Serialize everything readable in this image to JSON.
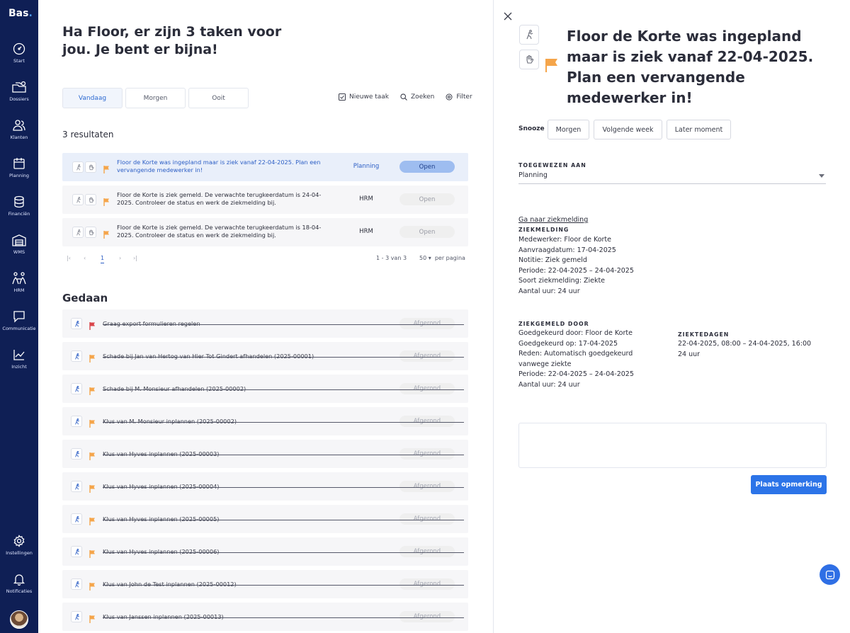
{
  "app": {
    "logo": "Bas",
    "logo_dot": "."
  },
  "sidebar": {
    "items": [
      {
        "label": "Start",
        "icon": "gauge-icon"
      },
      {
        "label": "Dossiers",
        "icon": "folders-icon"
      },
      {
        "label": "Klanten",
        "icon": "users-icon"
      },
      {
        "label": "Planning",
        "icon": "calendar-icon"
      },
      {
        "label": "Financiën",
        "icon": "coins-icon"
      },
      {
        "label": "WMS",
        "icon": "warehouse-icon"
      },
      {
        "label": "HRM",
        "icon": "people-icon"
      },
      {
        "label": "Communicatie",
        "icon": "chat-icon"
      },
      {
        "label": "Inzicht",
        "icon": "chart-icon"
      }
    ],
    "bottom": [
      {
        "label": "Instellingen",
        "icon": "gear-icon"
      },
      {
        "label": "Notificaties",
        "icon": "bell-icon"
      }
    ]
  },
  "main": {
    "greeting": "Ha Floor, er zijn 3 taken voor jou. Je bent er bijna!",
    "tabs": [
      {
        "label": "Vandaag",
        "active": true
      },
      {
        "label": "Morgen",
        "active": false
      },
      {
        "label": "Ooit",
        "active": false
      }
    ],
    "actions": {
      "new_task": "Nieuwe taak",
      "search": "Zoeken",
      "filter": "Filter"
    },
    "results_count": "3 resultaten",
    "tasks": [
      {
        "text": "Floor de Korte was ingepland maar is ziek vanaf 22-04-2025. Plan een vervangende medewerker in!",
        "dept": "Planning",
        "status": "Open",
        "active": true,
        "flag_color": "#f5a54a"
      },
      {
        "text": "Floor de Korte is ziek gemeld. De verwachte terugkeerdatum is 24-04-2025. Controleer de status en werk de ziekmelding bij.",
        "dept": "HRM",
        "status": "Open",
        "active": false,
        "flag_color": "#f5a54a"
      },
      {
        "text": "Floor de Korte is ziek gemeld. De verwachte terugkeerdatum is 18-04-2025. Controleer de status en werk de ziekmelding bij.",
        "dept": "HRM",
        "status": "Open",
        "active": false,
        "flag_color": "#f5a54a"
      }
    ],
    "pagination": {
      "current": "1",
      "range": "1 - 3 van 3",
      "per_page": "50",
      "per_page_label": "per pagina"
    },
    "done_title": "Gedaan",
    "done_tasks": [
      {
        "text": "Graag export formulieren regelen",
        "status": "Afgerond",
        "flag_color": "#d9454a"
      },
      {
        "text": "Schade bij Jan van Hertog van Hier Tot Gindert afhandelen (2025-00001)",
        "status": "Afgerond",
        "flag_color": "#f5a54a"
      },
      {
        "text": "Schade bij M. Monsieur afhandelen (2025-00002)",
        "status": "Afgerond",
        "flag_color": "#f5a54a"
      },
      {
        "text": "Klus van M. Monsieur inplannen (2025-00002)",
        "status": "Afgerond",
        "flag_color": "#f5a54a"
      },
      {
        "text": "Klus van Hyves inplannen (2025-00003)",
        "status": "Afgerond",
        "flag_color": "#f5a54a"
      },
      {
        "text": "Klus van Hyves inplannen (2025-00004)",
        "status": "Afgerond",
        "flag_color": "#f5a54a"
      },
      {
        "text": "Klus van Hyves inplannen (2025-00005)",
        "status": "Afgerond",
        "flag_color": "#f5a54a"
      },
      {
        "text": "Klus van Hyves inplannen (2025-00006)",
        "status": "Afgerond",
        "flag_color": "#f5a54a"
      },
      {
        "text": "Klus van John de Test inplannen (2025-00012)",
        "status": "Afgerond",
        "flag_color": "#f5a54a"
      },
      {
        "text": "Klus van Janssen inplannen (2025-00013)",
        "status": "Afgerond",
        "flag_color": "#f5a54a"
      }
    ]
  },
  "panel": {
    "title": "Floor de Korte was ingepland maar is ziek vanaf 22-04-2025. Plan een vervangende medewerker in!",
    "snooze_label": "Snooze",
    "snooze_options": [
      "Morgen",
      "Volgende week",
      "Later moment"
    ],
    "assigned_label": "TOEGEWEZEN AAN",
    "assigned_value": "Planning",
    "link": "Ga naar ziekmelding",
    "ziekmelding_label": "ZIEKMELDING",
    "ziekmelding_lines": [
      "Medewerker: Floor de Korte",
      "Aanvraagdatum: 17-04-2025",
      "Notitie: Ziek gemeld",
      "Periode: 22-04-2025 – 24-04-2025",
      "Soort ziekmelding: Ziekte",
      "Aantal uur: 24 uur"
    ],
    "ziekgemeld_label": "ZIEKGEMELD DOOR",
    "ziekgemeld_lines": [
      "Goedgekeurd door: Floor de Korte",
      "Goedgekeurd op: 17-04-2025",
      "Reden: Automatisch goedgekeurd vanwege ziekte",
      "Periode: 22-04-2025 – 24-04-2025",
      "Aantal uur: 24 uur"
    ],
    "ziektedagen_label": "ZIEKTEDAGEN",
    "ziektedagen_lines": [
      "22-04-2025, 08:00 – 24-04-2025, 16:00",
      "24 uur"
    ],
    "submit": "Plaats opmerking"
  },
  "colors": {
    "sidebar": "#0f1f55",
    "accent": "#2c74e8",
    "flag_orange": "#f5a54a",
    "flag_red": "#d9454a"
  }
}
